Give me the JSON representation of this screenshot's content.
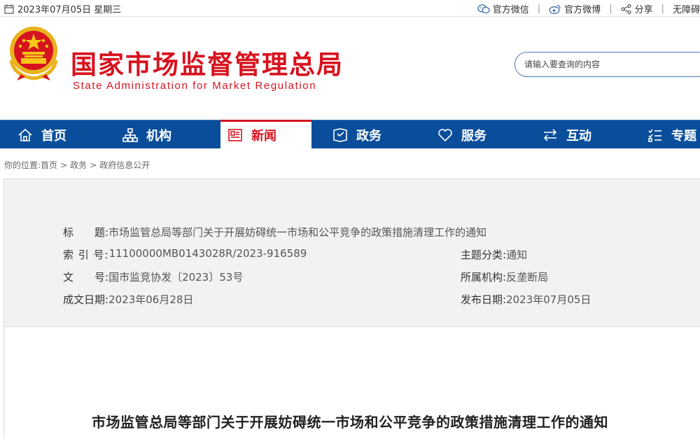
{
  "topbar": {
    "date": "2023年07月05日 星期三",
    "links": [
      {
        "label": "官方微信",
        "icon": "wechat-icon"
      },
      {
        "label": "官方微博",
        "icon": "weibo-icon"
      },
      {
        "label": "分享",
        "icon": "share-icon"
      },
      {
        "label": "无障碍",
        "icon": ""
      }
    ],
    "separator": "|"
  },
  "header": {
    "title_cn": "国家市场监督管理总局",
    "title_en": "State Administration for Market Regulation",
    "search_placeholder": "请输入要查询的内容"
  },
  "nav": [
    {
      "label": "首页",
      "icon": "home-icon"
    },
    {
      "label": "机构",
      "icon": "org-chart-icon"
    },
    {
      "label": "新闻",
      "icon": "news-icon",
      "active": true
    },
    {
      "label": "政务",
      "icon": "government-affairs-icon"
    },
    {
      "label": "服务",
      "icon": "heart-icon"
    },
    {
      "label": "互动",
      "icon": "swap-arrows-icon"
    },
    {
      "label": "专题",
      "icon": "topic-list-icon"
    }
  ],
  "breadcrumb": {
    "prefix": "你的位置:",
    "items": [
      "首页",
      "政务",
      "政府信息公开"
    ],
    "separator": ">"
  },
  "info": {
    "title_label": "标　　题:",
    "title_value": "市场监管总局等部门关于开展妨碍统一市场和公平竞争的政策措施清理工作的通知",
    "index_label": "索 引 号:",
    "index_value": "11100000MB0143028R/2023-916589",
    "docno_label": "文　　号:",
    "docno_value": "国市监竞协发〔2023〕53号",
    "created_label": "成文日期:",
    "created_value": "2023年06月28日",
    "topic_label": "主题分类:",
    "topic_value": "通知",
    "org_label": "所属机构:",
    "org_value": "反垄断局",
    "published_label": "发布日期:",
    "published_value": "2023年07月05日"
  },
  "document": {
    "title": "市场监管总局等部门关于开展妨碍统一市场和公平竞争的政策措施清理工作的通知"
  },
  "colors": {
    "brand_red": "#d7131f",
    "nav_blue": "#0a4e9b"
  }
}
